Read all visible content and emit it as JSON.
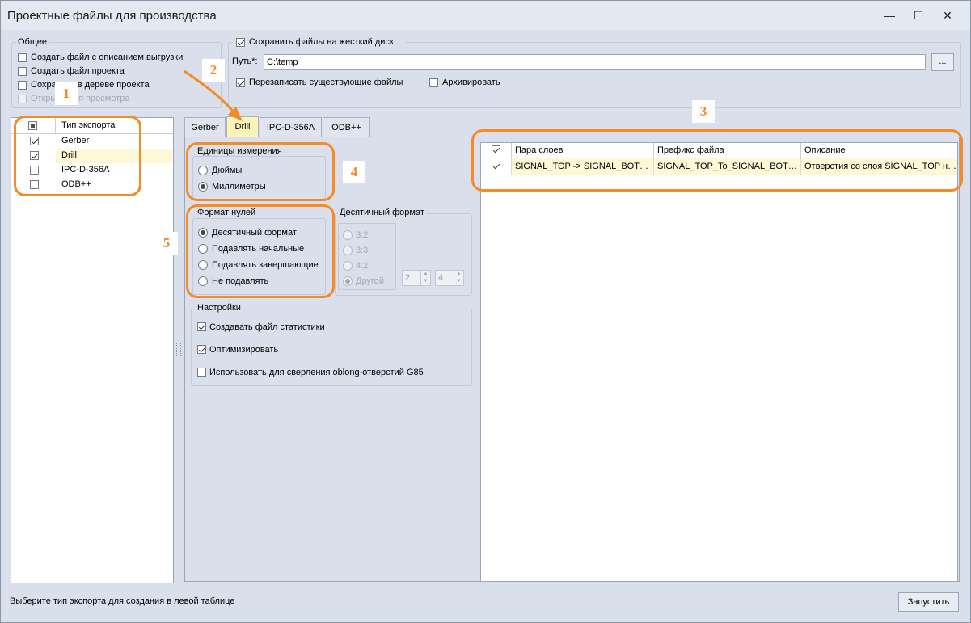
{
  "window": {
    "title": "Проектные файлы для производства",
    "minimize_icon": "minimize-icon",
    "maximize_icon": "maximize-icon",
    "close_icon": "close-icon"
  },
  "general": {
    "title": "Общее",
    "options": [
      {
        "label": "Создать файл с описанием выгрузки",
        "checked": false,
        "disabled": false
      },
      {
        "label": "Создать файл проекта",
        "checked": false,
        "disabled": false
      },
      {
        "label": "Сохранить в дереве проекта",
        "checked": false,
        "disabled": false
      },
      {
        "label": "Открыть для просмотра",
        "checked": false,
        "disabled": true
      }
    ]
  },
  "save": {
    "save_to_disk_label": "Сохранить файлы на жесткий диск",
    "save_to_disk_checked": true,
    "path_label": "Путь*:",
    "path_value": "C:\\temp",
    "browse_label": "...",
    "overwrite_label": "Перезаписать существующие файлы",
    "overwrite_checked": true,
    "archive_label": "Архивировать",
    "archive_checked": false
  },
  "export_types": {
    "header": "Тип экспорта",
    "rows": [
      {
        "label": "Gerber",
        "checked": true
      },
      {
        "label": "Drill",
        "checked": true
      },
      {
        "label": "IPC-D-356A",
        "checked": false
      },
      {
        "label": "ODB++",
        "checked": false
      }
    ],
    "selected_index": 1
  },
  "tabs": [
    {
      "label": "Gerber"
    },
    {
      "label": "Drill"
    },
    {
      "label": "IPC-D-356A"
    },
    {
      "label": "ODB++"
    }
  ],
  "active_tab": "Drill",
  "units": {
    "title": "Единицы измерения",
    "options": [
      "Дюймы",
      "Миллиметры"
    ],
    "selected": "Миллиметры"
  },
  "zero_format": {
    "title": "Формат нулей",
    "options": [
      "Десятичный формат",
      "Подавлять начальные",
      "Подавлять завершающие",
      "Не подавлять"
    ],
    "selected": "Десятичный формат"
  },
  "decimal_format": {
    "title": "Десятичный формат",
    "options": [
      "3:2",
      "3:3",
      "4:2",
      "Другой"
    ],
    "selected": "Другой",
    "spin1": "2",
    "spin2": "4"
  },
  "settings": {
    "title": "Настройки",
    "options": [
      {
        "label": "Создавать файл статистики",
        "checked": true
      },
      {
        "label": "Оптимизировать",
        "checked": true
      },
      {
        "label": "Использовать для сверления oblong-отверстий G85",
        "checked": false
      }
    ]
  },
  "layers_table": {
    "columns": [
      "Пара слоев",
      "Префикс файла",
      "Описание"
    ],
    "rows": [
      {
        "checked": true,
        "pair": "SIGNAL_TOP -> SIGNAL_BOTTOM",
        "prefix": "SIGNAL_TOP_To_SIGNAL_BOTTOM",
        "description": "Отверстия со слоя SIGNAL_TOP на слой SIGNAL_BOTTOM"
      }
    ]
  },
  "status_text": "Выберите тип экспорта для создания в левой таблице",
  "run_button": "Запустить",
  "annotations": [
    "1",
    "2",
    "3",
    "4",
    "5"
  ],
  "colors": {
    "accent_orange": "#f58a28",
    "active_tab_bg": "#fbf3b7",
    "selected_row_bg": "#fff8d6",
    "window_bg": "#d9dfeb"
  }
}
